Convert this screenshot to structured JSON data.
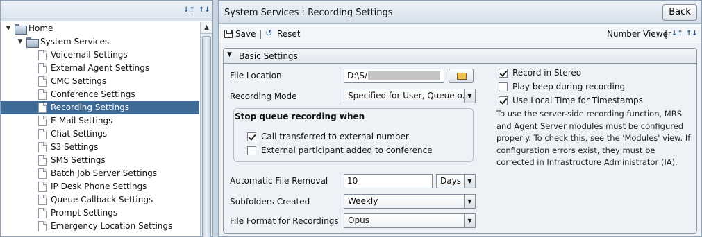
{
  "tree": {
    "items": [
      {
        "label": "Home",
        "level": 0,
        "type": "folder",
        "expanded": true
      },
      {
        "label": "System Services",
        "level": 1,
        "type": "folder",
        "expanded": true
      },
      {
        "label": "Voicemail Settings",
        "level": 2,
        "type": "doc"
      },
      {
        "label": "External Agent Settings",
        "level": 2,
        "type": "doc"
      },
      {
        "label": "CMC Settings",
        "level": 2,
        "type": "doc"
      },
      {
        "label": "Conference Settings",
        "level": 2,
        "type": "doc"
      },
      {
        "label": "Recording Settings",
        "level": 2,
        "type": "doc",
        "selected": true
      },
      {
        "label": "E-Mail Settings",
        "level": 2,
        "type": "doc"
      },
      {
        "label": "Chat Settings",
        "level": 2,
        "type": "doc"
      },
      {
        "label": "S3 Settings",
        "level": 2,
        "type": "doc"
      },
      {
        "label": "SMS Settings",
        "level": 2,
        "type": "doc"
      },
      {
        "label": "Batch Job Server Settings",
        "level": 2,
        "type": "doc"
      },
      {
        "label": "IP Desk Phone Settings",
        "level": 2,
        "type": "doc"
      },
      {
        "label": "Queue Callback Settings",
        "level": 2,
        "type": "doc"
      },
      {
        "label": "Prompt Settings",
        "level": 2,
        "type": "doc"
      },
      {
        "label": "Emergency Location Settings",
        "level": 2,
        "type": "doc"
      }
    ]
  },
  "header": {
    "title": "System Services : Recording Settings",
    "back_label": "Back"
  },
  "toolbar": {
    "save_label": "Save",
    "separator": "|",
    "reset_label": "Reset",
    "viewer_label": "Number Viewer",
    "viewer_separator": "|"
  },
  "section": {
    "title": "Basic Settings"
  },
  "form": {
    "file_location_label": "File Location",
    "file_location_value": "D:\\S/",
    "recording_mode_label": "Recording Mode",
    "recording_mode_value": "Specified for User, Queue o...",
    "stop_queue_title": "Stop queue recording when",
    "call_transferred_label": "Call transferred to external number",
    "call_transferred_checked": true,
    "external_participant_label": "External participant added to conference",
    "external_participant_checked": false,
    "auto_removal_label": "Automatic File Removal",
    "auto_removal_value": "10",
    "auto_removal_unit": "Days",
    "subfolders_label": "Subfolders Created",
    "subfolders_value": "Weekly",
    "file_format_label": "File Format for Recordings",
    "file_format_value": "Opus"
  },
  "right_options": {
    "record_stereo_label": "Record in Stereo",
    "record_stereo_checked": true,
    "play_beep_label": "Play beep during recording",
    "play_beep_checked": false,
    "local_time_label": "Use Local Time for Timestamps",
    "local_time_checked": true,
    "info_text": "To use the server-side recording function, MRS and Agent Server modules must be configured properly. To check this, see the 'Modules' view. If configuration errors exist, they must be corrected in Infrastructure Administrator (IA)."
  }
}
